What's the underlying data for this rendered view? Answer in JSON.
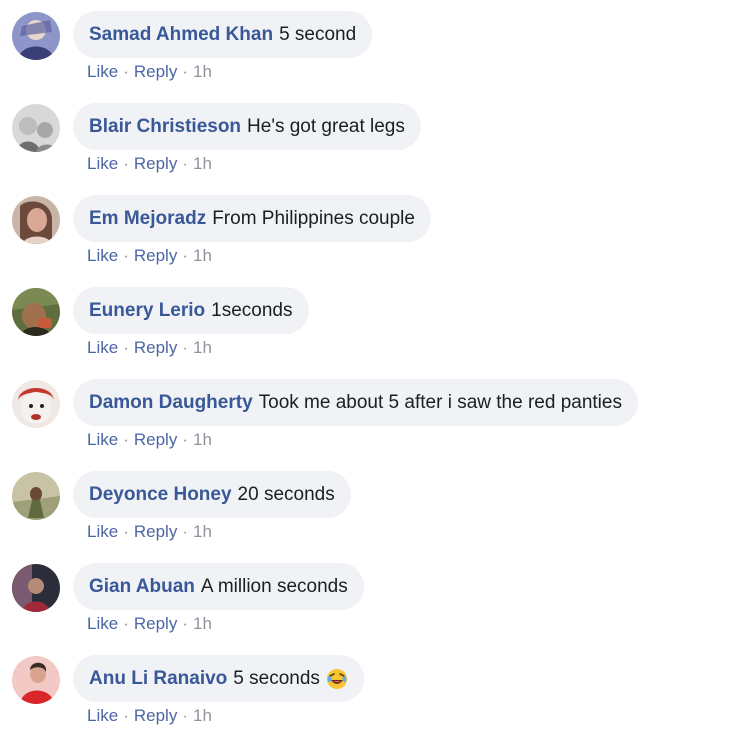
{
  "comments": [
    {
      "author": "Samad Ahmed Khan",
      "text": "5 second",
      "like": "Like",
      "reply": "Reply",
      "time": "1h",
      "avatar_icon": "avatar-samad",
      "avatar_colors": [
        "#8d95c9",
        "#3b3f78"
      ]
    },
    {
      "author": "Blair Christieson",
      "text": "He's got great legs",
      "like": "Like",
      "reply": "Reply",
      "time": "1h",
      "avatar_icon": "avatar-blair",
      "avatar_colors": [
        "#d8d8d8",
        "#6e6e6e"
      ]
    },
    {
      "author": "Em Mejoradz",
      "text": "From Philippines couple",
      "like": "Like",
      "reply": "Reply",
      "time": "1h",
      "avatar_icon": "avatar-em",
      "avatar_colors": [
        "#d9a996",
        "#6b4a3c"
      ]
    },
    {
      "author": "Eunery Lerio",
      "text": "1seconds",
      "like": "Like",
      "reply": "Reply",
      "time": "1h",
      "avatar_icon": "avatar-eunery",
      "avatar_colors": [
        "#5f6e3f",
        "#2c2a1e"
      ]
    },
    {
      "author": "Damon Daugherty",
      "text": "Took me about 5 after i saw the red panties",
      "like": "Like",
      "reply": "Reply",
      "time": "1h",
      "avatar_icon": "avatar-damon",
      "avatar_colors": [
        "#f0e8e4",
        "#c23a2a"
      ]
    },
    {
      "author": "Deyonce Honey",
      "text": "20 seconds",
      "like": "Like",
      "reply": "Reply",
      "time": "1h",
      "avatar_icon": "avatar-deyonce",
      "avatar_colors": [
        "#c9c3a5",
        "#5f6a3f"
      ]
    },
    {
      "author": "Gian Abuan",
      "text": "A million seconds",
      "like": "Like",
      "reply": "Reply",
      "time": "1h",
      "avatar_icon": "avatar-gian",
      "avatar_colors": [
        "#7a5a70",
        "#2b2d3a"
      ]
    },
    {
      "author": "Anu Li Ranaivo",
      "text": "5 seconds",
      "like": "Like",
      "reply": "Reply",
      "time": "1h",
      "avatar_icon": "avatar-anu",
      "avatar_colors": [
        "#f2c9c4",
        "#d9262a"
      ],
      "emoji": "laughing-emoji-icon"
    }
  ]
}
